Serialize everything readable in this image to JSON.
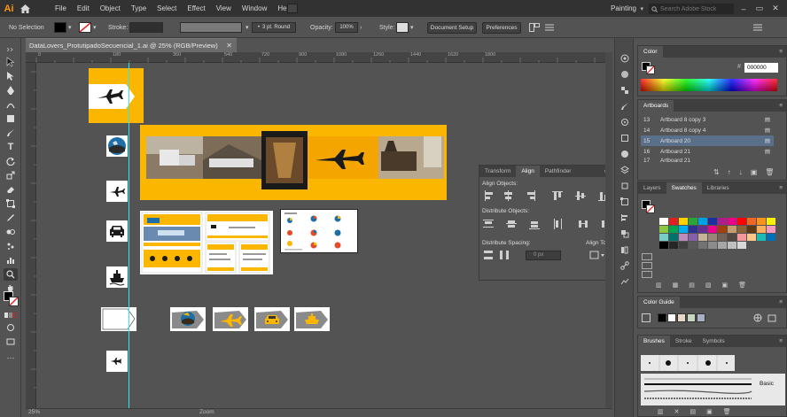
{
  "app": {
    "logo": "Ai",
    "menus": [
      "File",
      "Edit",
      "Object",
      "Type",
      "Select",
      "Effect",
      "View",
      "Window",
      "Help"
    ],
    "workspace": "Painting",
    "search_placeholder": "Search Adobe Stock"
  },
  "control_bar": {
    "selection": "No Selection",
    "stroke_label": "Stroke:",
    "brush": "3 pt. Round",
    "opacity_label": "Opacity:",
    "opacity_value": "100%",
    "style_label": "Style:",
    "document_setup": "Document Setup",
    "preferences": "Preferences"
  },
  "document": {
    "tab_title": "DataLovers_ProtutipadoSecuencial_1.ai @ 25% (RGB/Preview)",
    "zoom": "25%",
    "status_tool": "Zoom"
  },
  "ruler": {
    "ticks": [
      "0",
      "180",
      "360",
      "540",
      "720",
      "900",
      "1080",
      "1260",
      "1440",
      "1620",
      "1800"
    ]
  },
  "align_panel": {
    "tabs": [
      "Transform",
      "Align",
      "Pathfinder"
    ],
    "align_objects": "Align Objects:",
    "distribute_objects": "Distribute Objects:",
    "distribute_spacing": "Distribute Spacing:",
    "align_to": "Align To:",
    "spacing_value": "0 px"
  },
  "color_panel": {
    "title": "Color",
    "hex_value": "000000",
    "hex_label": "#"
  },
  "artboards_panel": {
    "title": "Artboards",
    "rows": [
      {
        "num": "13",
        "name": "Artboard 8 copy 3"
      },
      {
        "num": "14",
        "name": "Artboard 8 copy 4"
      },
      {
        "num": "15",
        "name": "Artboard 20"
      },
      {
        "num": "16",
        "name": "Artboard 21"
      },
      {
        "num": "17",
        "name": "Artboard 21"
      }
    ],
    "selected_index": 2
  },
  "swatches_panel": {
    "tabs": [
      "Layers",
      "Swatches",
      "Libraries"
    ],
    "colors": [
      "#ffffff",
      "#e02020",
      "#ffd200",
      "#27a737",
      "#00a0e4",
      "#1b2fa0",
      "#ad1e8a",
      "#ec008c",
      "#ff0000",
      "#f26522",
      "#f7941d",
      "#fff200",
      "#8dc63f",
      "#00a651",
      "#00aeef",
      "#2e3192",
      "#662d91",
      "#ec008c",
      "#a0410d",
      "#c69c6d",
      "#8c6239",
      "#603913",
      "#fbaf5d",
      "#f49ac1",
      "#7accc8",
      "#00746b",
      "#bd8cbf",
      "#855fa8",
      "#c7b299",
      "#998675",
      "#736357",
      "#534741",
      "#f5989d",
      "#fdc689",
      "#1cbbb4",
      "#0072bc",
      "#000000",
      "#262626",
      "#404040",
      "#595959",
      "#737373",
      "#8c8c8c",
      "#a6a6a6",
      "#bfbfbf",
      "#d9d9d9"
    ]
  },
  "color_guide_panel": {
    "title": "Color Guide",
    "swatches": [
      "#000000",
      "#ffffff",
      "#e8d8c8",
      "#c8d8c0",
      "#a8b0c8"
    ]
  },
  "brushes_panel": {
    "tabs": [
      "Brushes",
      "Stroke",
      "Symbols"
    ],
    "basic_label": "Basic"
  }
}
